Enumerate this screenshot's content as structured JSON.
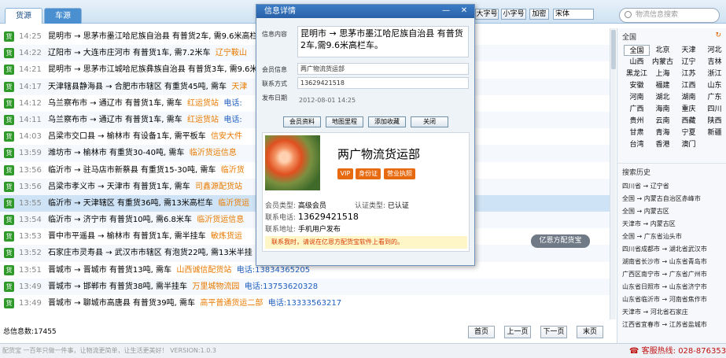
{
  "tabs": [
    "货源",
    "车源"
  ],
  "toolbar": {
    "big_font": "大字号",
    "small_font": "小字号",
    "encrypt": "加密",
    "font_select": "宋体"
  },
  "search": {
    "placeholder": "物流信息搜索"
  },
  "rows": [
    {
      "icon": "货",
      "time": "14:25",
      "text": "昆明市 → 思茅市墨江哈尼族自治县 有普货2车, 需9.6米高栏车",
      "company": "",
      "phone": ""
    },
    {
      "icon": "货",
      "time": "14:22",
      "text": "辽阳市 → 大连市庄河市 有普货1车, 需7.2米车",
      "company": "辽宁鞍山",
      "phone": ""
    },
    {
      "icon": "货",
      "time": "14:21",
      "text": "昆明市 → 思茅市江城哈尼族彝族自治县 有普货3车, 需9.6米",
      "company": "",
      "phone": ""
    },
    {
      "icon": "货",
      "time": "14:17",
      "text": "天津辖县静海县 → 合肥市市辖区 有重货45吨, 需车",
      "company": "天津",
      "phone": ""
    },
    {
      "icon": "货",
      "time": "14:12",
      "text": "乌兰察布市 → 通辽市 有普货1车, 需车",
      "company": "红运货站",
      "phone": "电话:"
    },
    {
      "icon": "货",
      "time": "14:11",
      "text": "乌兰察布市 → 通辽市 有普货1车, 需车",
      "company": "红运货站",
      "phone": "电话:"
    },
    {
      "icon": "货",
      "time": "14:03",
      "text": "吕梁市交口县 → 榆林市 有设备1车, 需平板车",
      "company": "信安大件",
      "phone": ""
    },
    {
      "icon": "货",
      "time": "13:59",
      "text": "潍坊市 → 榆林市 有重货30-40吨, 需车",
      "company": "临沂货运信息",
      "phone": ""
    },
    {
      "icon": "货",
      "time": "13:56",
      "text": "临沂市 → 驻马店市新蔡县 有重货15-30吨, 需车",
      "company": "临沂货",
      "phone": ""
    },
    {
      "icon": "货",
      "time": "13:56",
      "text": "吕梁市孝义市 → 天津市 有普货1车, 需车",
      "company": "司鑫源配货站",
      "phone": ""
    },
    {
      "icon": "货",
      "time": "13:55",
      "text": "临沂市 → 天津辖区 有重货36吨, 需13米高栏车",
      "company": "临沂货运",
      "phone": ""
    },
    {
      "icon": "货",
      "time": "13:54",
      "text": "临沂市 → 济宁市 有普货10吨, 需6.8米车",
      "company": "临沂货运信息",
      "phone": ""
    },
    {
      "icon": "货",
      "time": "13:53",
      "text": "晋中市平遥县 → 榆林市 有普货1车, 需半挂车",
      "company": "敏炼货运",
      "phone": ""
    },
    {
      "icon": "货",
      "time": "13:52",
      "text": "石家庄市灵寿县 → 武汉市市辖区 有泡货22吨, 需13米半挂",
      "company": "",
      "phone": ""
    },
    {
      "icon": "货",
      "time": "13:51",
      "text": "晋城市 → 晋城市 有普货13吨, 需车",
      "company": "山西诚信配货站",
      "phone": "电话:13834365205"
    },
    {
      "icon": "货",
      "time": "13:49",
      "text": "晋城市 → 邯郸市 有普货38吨, 需半挂车",
      "company": "万里城物流园",
      "phone": "电话:13753620328"
    },
    {
      "icon": "货",
      "time": "13:49",
      "text": "晋城市 → 聊城市高唐县 有普货39吨, 需车",
      "company": "高平普通货运二部",
      "phone": "电话:13333563217"
    }
  ],
  "total": "总信息数:17455",
  "pager": [
    "首页",
    "上一页",
    "下一页",
    "末页"
  ],
  "status": "配货宝 一百年只做一件事，让物流更简单，让生活更美好！   VERSION:1.0.3",
  "hotline": "客服热线: 028-87635360",
  "right": {
    "region_title": "全国",
    "regions": [
      "全国",
      "北京",
      "天津",
      "河北",
      "山西",
      "内蒙古",
      "辽宁",
      "吉林",
      "黑龙江",
      "上海",
      "江苏",
      "浙江",
      "安徽",
      "福建",
      "江西",
      "山东",
      "河南",
      "湖北",
      "湖南",
      "广东",
      "广西",
      "海南",
      "重庆",
      "四川",
      "贵州",
      "云南",
      "西藏",
      "陕西",
      "甘肃",
      "青海",
      "宁夏",
      "新疆",
      "台湾",
      "香港",
      "澳门"
    ],
    "history_title": "搜索历史",
    "history": [
      "四川省 → 辽宁省",
      "全国 → 内蒙古自治区赤峰市",
      "全国 → 内蒙古区",
      "天津市 → 内蒙古区",
      "全国 → 广东省汕头市",
      "四川省成都市 → 湖北省武汉市",
      "湖南省长沙市 → 山东省青岛市",
      "广西区南宁市 → 广东省广州市",
      "山东省日照市 → 山东省济宁市",
      "山东省临沂市 → 河南省焦作市",
      "天津市 → 河北省石家庄",
      "江西省宜春市 → 江苏省盐城市"
    ]
  },
  "dialog": {
    "title": "信息详情",
    "content_label": "信息内容",
    "content": "昆明市 → 思茅市墨江哈尼族自治县 有普货2车,需9.6米高栏车。",
    "member_label": "会员信息",
    "member": "两广物流货运部",
    "contact_label": "联系方式",
    "contact": "13629421518",
    "date_label": "发布日期",
    "date": "2012-08-01 14:25",
    "buttons": [
      "会员资料",
      "地图里程",
      "添加收藏",
      "关闭"
    ],
    "company": "两广物流货运部",
    "badges": [
      "VIP",
      "身份证",
      "营业执照"
    ],
    "member_type_label": "会员类型:",
    "member_type": "高级会员",
    "auth_label": "认证类型:",
    "auth": "已认证",
    "phone_label": "联系电话:",
    "phone": "13629421518",
    "addr_label": "联系地址:",
    "addr": "手机用户发布",
    "warning": "联系我时，请说在亿恩方配货宝软件上看到的。"
  },
  "tip": "亿恩方配货宝"
}
